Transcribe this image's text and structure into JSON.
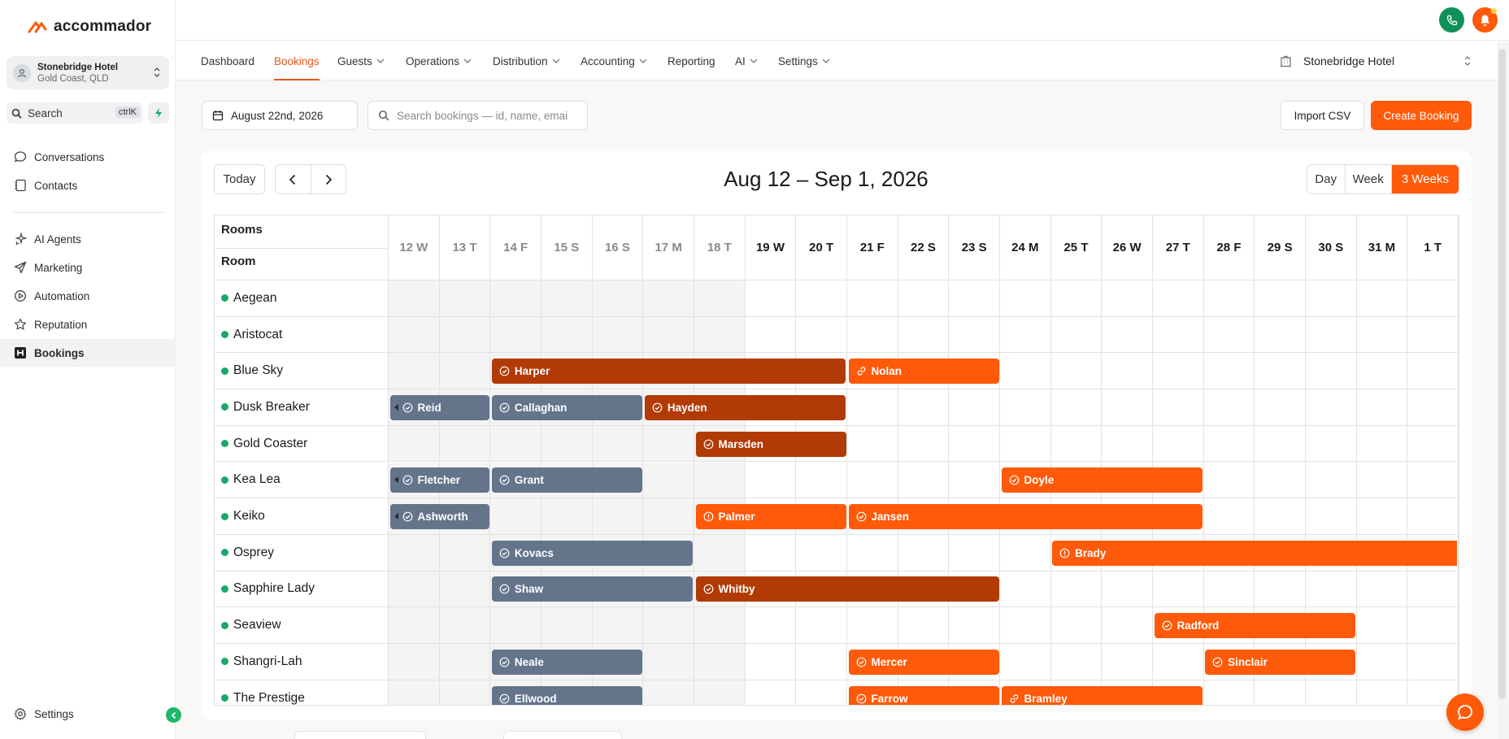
{
  "brand": {
    "name": "accommador",
    "accent": "#ff5a0a"
  },
  "sidebar": {
    "hotel": {
      "name": "Stonebridge Hotel",
      "location": "Gold Coast, QLD"
    },
    "search": {
      "label": "Search",
      "shortcut": "ctrlK"
    },
    "items": [
      {
        "label": "Conversations",
        "icon": "chat-bubble-icon"
      },
      {
        "label": "Contacts",
        "icon": "contacts-book-icon"
      },
      {
        "label": "AI Agents",
        "icon": "sparkles-icon"
      },
      {
        "label": "Marketing",
        "icon": "send-icon"
      },
      {
        "label": "Automation",
        "icon": "automation-icon"
      },
      {
        "label": "Reputation",
        "icon": "star-icon"
      },
      {
        "label": "Bookings",
        "icon": "bookings-icon",
        "active": true
      }
    ],
    "settings_label": "Settings"
  },
  "nav": {
    "tabs": [
      {
        "label": "Dashboard",
        "dropdown": false
      },
      {
        "label": "Bookings",
        "dropdown": false,
        "active": true
      },
      {
        "label": "Guests",
        "dropdown": true
      },
      {
        "label": "Operations",
        "dropdown": true
      },
      {
        "label": "Distribution",
        "dropdown": true
      },
      {
        "label": "Accounting",
        "dropdown": true
      },
      {
        "label": "Reporting",
        "dropdown": false
      },
      {
        "label": "AI",
        "dropdown": true
      },
      {
        "label": "Settings",
        "dropdown": true
      }
    ],
    "property": "Stonebridge Hotel"
  },
  "toolbar": {
    "date": "August 22nd, 2026",
    "search_placeholder": "Search bookings — id, name, email",
    "import_label": "Import CSV",
    "create_label": "Create Booking"
  },
  "calendar": {
    "today_label": "Today",
    "range_title": "Aug 12 – Sep 1, 2026",
    "views": [
      "Day",
      "Week",
      "3 Weeks"
    ],
    "selected_view": "3 Weeks",
    "rooms_header": "Rooms",
    "room_header": "Room",
    "days": [
      "12 W",
      "13 T",
      "14 F",
      "15 S",
      "16 S",
      "17 M",
      "18 T",
      "19 W",
      "20 T",
      "21 F",
      "22 S",
      "23 S",
      "24 M",
      "25 T",
      "26 W",
      "27 T",
      "28 F",
      "29 S",
      "30 S",
      "31 M",
      "1 T"
    ],
    "past_day_count": 7,
    "rooms": [
      "Aegean",
      "Aristocat",
      "Blue Sky",
      "Dusk Breaker",
      "Gold Coaster",
      "Kea Lea",
      "Keiko",
      "Osprey",
      "Sapphire Lady",
      "Seaview",
      "Shangri-Lah",
      "The Prestige"
    ],
    "status_colors": {
      "checked_out": "#64748b",
      "in_house": "#b23a05",
      "confirmed": "#ff5a0a"
    },
    "bookings": [
      {
        "guest": "Harper",
        "room": 2,
        "start": 2,
        "end": 8,
        "status": "in_house",
        "icon": "check-circle-icon"
      },
      {
        "guest": "Nolan",
        "room": 2,
        "start": 9,
        "end": 11,
        "status": "confirmed",
        "icon": "link-icon"
      },
      {
        "guest": "Reid",
        "room": 3,
        "start": 0,
        "end": 1,
        "status": "checked_out",
        "icon": "check-circle-icon",
        "continues": true
      },
      {
        "guest": "Callaghan",
        "room": 3,
        "start": 2,
        "end": 4,
        "status": "checked_out",
        "icon": "check-circle-icon"
      },
      {
        "guest": "Hayden",
        "room": 3,
        "start": 5,
        "end": 8,
        "status": "in_house",
        "icon": "check-circle-icon"
      },
      {
        "guest": "Marsden",
        "room": 4,
        "start": 6,
        "end": 8,
        "status": "in_house",
        "icon": "check-circle-icon"
      },
      {
        "guest": "Fletcher",
        "room": 5,
        "start": 0,
        "end": 1,
        "status": "checked_out",
        "icon": "check-circle-icon",
        "continues": true
      },
      {
        "guest": "Grant",
        "room": 5,
        "start": 2,
        "end": 4,
        "status": "checked_out",
        "icon": "check-circle-icon"
      },
      {
        "guest": "Doyle",
        "room": 5,
        "start": 12,
        "end": 15,
        "status": "confirmed",
        "icon": "check-circle-icon"
      },
      {
        "guest": "Ashworth",
        "room": 6,
        "start": 0,
        "end": 1,
        "status": "checked_out",
        "icon": "check-circle-icon",
        "continues": true
      },
      {
        "guest": "Palmer",
        "room": 6,
        "start": 6,
        "end": 8,
        "status": "confirmed",
        "icon": "info-circle-icon"
      },
      {
        "guest": "Jansen",
        "room": 6,
        "start": 9,
        "end": 15,
        "status": "confirmed",
        "icon": "check-circle-icon"
      },
      {
        "guest": "Kovacs",
        "room": 7,
        "start": 2,
        "end": 5,
        "status": "checked_out",
        "icon": "check-circle-icon"
      },
      {
        "guest": "Brady",
        "room": 7,
        "start": 13,
        "end": 20,
        "status": "confirmed",
        "icon": "info-circle-icon"
      },
      {
        "guest": "Shaw",
        "room": 8,
        "start": 2,
        "end": 5,
        "status": "checked_out",
        "icon": "check-circle-icon"
      },
      {
        "guest": "Whitby",
        "room": 8,
        "start": 6,
        "end": 11,
        "status": "in_house",
        "icon": "check-circle-icon"
      },
      {
        "guest": "Radford",
        "room": 9,
        "start": 15,
        "end": 18,
        "status": "confirmed",
        "icon": "check-circle-icon"
      },
      {
        "guest": "Neale",
        "room": 10,
        "start": 2,
        "end": 4,
        "status": "checked_out",
        "icon": "check-circle-icon"
      },
      {
        "guest": "Mercer",
        "room": 10,
        "start": 9,
        "end": 11,
        "status": "confirmed",
        "icon": "check-circle-icon"
      },
      {
        "guest": "Sinclair",
        "room": 10,
        "start": 16,
        "end": 18,
        "status": "confirmed",
        "icon": "check-circle-icon"
      },
      {
        "guest": "Ellwood",
        "room": 11,
        "start": 2,
        "end": 4,
        "status": "checked_out",
        "icon": "check-circle-icon"
      },
      {
        "guest": "Farrow",
        "room": 11,
        "start": 9,
        "end": 11,
        "status": "confirmed",
        "icon": "check-circle-icon"
      },
      {
        "guest": "Bramley",
        "room": 11,
        "start": 12,
        "end": 15,
        "status": "confirmed",
        "icon": "link-icon"
      }
    ]
  }
}
